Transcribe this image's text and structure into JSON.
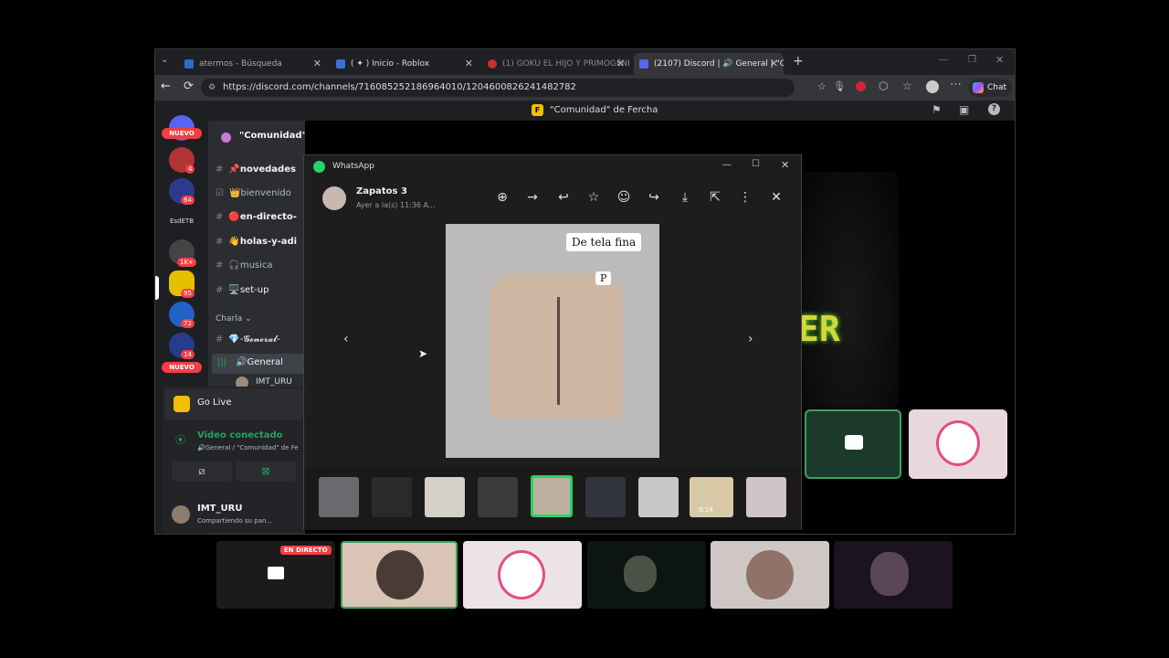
{
  "browser": {
    "tabs": [
      {
        "label": "atermos - Búsqueda"
      },
      {
        "label": "( ✦ ) Inicio - Roblox"
      },
      {
        "label": "(1) GOKU EL HIJO Y PRIMOGÉNITO"
      },
      {
        "label": "(2107) Discord | 🔊 General | \"C"
      }
    ],
    "url": "https://discord.com/channels/716085252186964010/1204600826241482782",
    "chat_label": "Chat"
  },
  "discord": {
    "window_title": "\"Comunidad\" de Fercha",
    "server_name": "\"Comunidad\" de F...",
    "server_list": {
      "nuevo_top": "NUEVO",
      "nuevo_bottom": "NUEVO",
      "badges": [
        "4",
        "64",
        "1K+",
        "95",
        "72",
        "14"
      ],
      "text_server": "EsdETB"
    },
    "channels": [
      {
        "label": "📌novedades"
      },
      {
        "label": "👑bienvenido"
      },
      {
        "label": "🔴en-directo-"
      },
      {
        "label": "👋holas-y-adi"
      },
      {
        "label": "🎧musica"
      },
      {
        "label": "🖥️set-up"
      }
    ],
    "category": "Charla",
    "voice_channels": [
      {
        "label": "💎-𝓖𝓮𝓷𝓮𝓻𝓪𝓵-"
      },
      {
        "label": "🔊General"
      }
    ],
    "voice_user": "IMT_URU",
    "go_live": "Go Live",
    "video_status": "Video conectado",
    "video_sub": "🔊General / \"Comunidad\" de Fe",
    "user_name": "IMT_URU",
    "user_status": "Compartiendo su pan..."
  },
  "whatsapp": {
    "title": "WhatsApp",
    "contact_name": "Zapatos 3",
    "timestamp": "Ayer a la(s) 11:36 A...",
    "image_caption": "De tela fina",
    "image_tag": "P",
    "video_duration": "0:14",
    "toolbar_icons": [
      "zoom-in-icon",
      "forward-icon",
      "reply-icon",
      "star-icon",
      "emoji-icon",
      "share-icon",
      "download-icon",
      "open-external-icon",
      "more-icon",
      "close-icon"
    ]
  },
  "streams": {
    "live_badge": "EN DIRECTO"
  },
  "colors": {
    "discord_green": "#23a55a",
    "discord_red": "#f23f43",
    "whatsapp_green": "#25d366",
    "accent_border": "#3ba55d"
  }
}
